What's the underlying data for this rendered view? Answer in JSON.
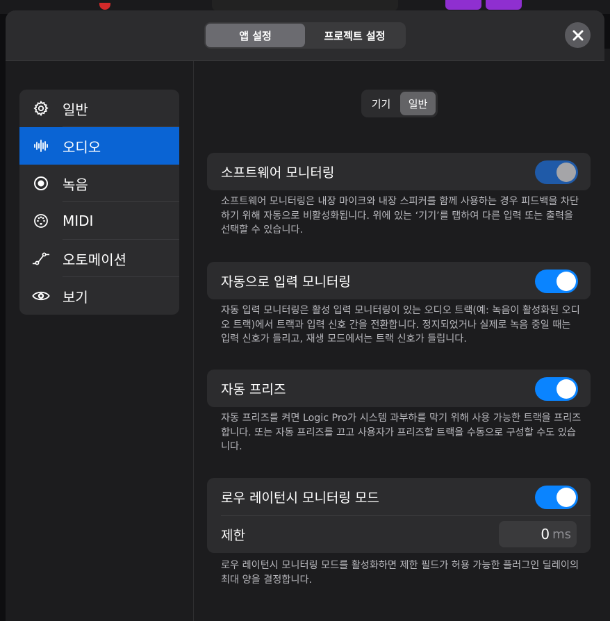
{
  "header": {
    "tabs": [
      {
        "label": "앱 설정",
        "active": true
      },
      {
        "label": "프로젝트 설정",
        "active": false
      }
    ],
    "close_icon": "close-icon"
  },
  "sidebar": {
    "items": [
      {
        "label": "일반",
        "icon": "gear-icon",
        "active": false
      },
      {
        "label": "오디오",
        "icon": "waveform-icon",
        "active": true
      },
      {
        "label": "녹음",
        "icon": "record-icon",
        "active": false
      },
      {
        "label": "MIDI",
        "icon": "midi-icon",
        "active": false
      },
      {
        "label": "오토메이션",
        "icon": "automation-icon",
        "active": false
      },
      {
        "label": "보기",
        "icon": "eye-icon",
        "active": false
      }
    ]
  },
  "subtabs": [
    {
      "label": "기기",
      "active": false
    },
    {
      "label": "일반",
      "active": true
    }
  ],
  "settings": {
    "software_monitoring": {
      "title": "소프트웨어 모니터링",
      "enabled": true,
      "description": "소프트웨어 모니터링은 내장 마이크와 내장 스피커를 함께 사용하는 경우 피드백을 차단하기 위해 자동으로 비활성화됩니다. 위에 있는 ‘기기’를 탭하여 다른 입력 또는 출력을 선택할 수 있습니다."
    },
    "auto_input_monitoring": {
      "title": "자동으로 입력 모니터링",
      "enabled": true,
      "description": "자동 입력 모니터링은 활성 입력 모니터링이 있는 오디오 트랙(예: 녹음이 활성화된 오디오 트랙)에서 트랙과 입력 신호 간을 전환합니다. 정지되었거나 실제로 녹음 중일 때는 입력 신호가 들리고, 재생 모드에서는 트랙 신호가 들립니다."
    },
    "auto_freeze": {
      "title": "자동 프리즈",
      "enabled": true,
      "description": "자동 프리즈를 켜면 Logic Pro가 시스템 과부하를 막기 위해 사용 가능한 트랙을 프리즈합니다. 또는 자동 프리즈를 끄고 사용자가 프리즈할 트랙을 수동으로 구성할 수도 있습니다."
    },
    "low_latency": {
      "title": "로우 레이턴시 모니터링 모드",
      "enabled": true,
      "limit_label": "제한",
      "limit_value": "0",
      "limit_unit": "ms",
      "description": "로우 레이턴시 모니터링 모드를 활성화하면 제한 필드가 허용 가능한 플러그인 딜레이의 최대 양을 결정합니다."
    }
  },
  "colors": {
    "accent": "#0a84ff",
    "selected": "#0a64d4",
    "panel": "#2c2c2e",
    "background": "#1c1c1e"
  }
}
